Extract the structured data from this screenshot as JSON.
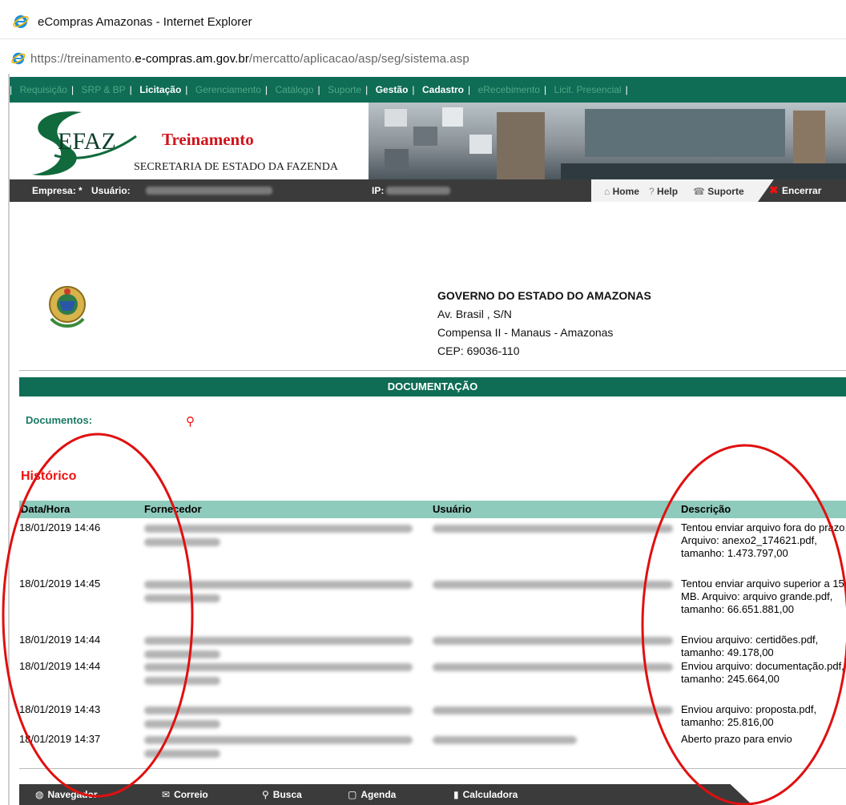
{
  "window": {
    "title": "eCompras Amazonas - Internet Explorer"
  },
  "address": {
    "scheme": "https://treinamento.",
    "domain": "e-compras.am.gov.br",
    "path": "/mercatto/aplicacao/asp/seg/sistema.asp"
  },
  "topnav": {
    "items": [
      {
        "label": "Requisição",
        "active": false
      },
      {
        "label": "SRP & BP",
        "active": false
      },
      {
        "label": "Licitação",
        "active": true
      },
      {
        "label": "Gerenciamento",
        "active": false
      },
      {
        "label": "Catálogo",
        "active": false
      },
      {
        "label": "Suporte",
        "active": false
      },
      {
        "label": "Gestão",
        "active": true
      },
      {
        "label": "Cadastro",
        "active": true
      },
      {
        "label": "eRecebimento",
        "active": false
      },
      {
        "label": "Licit. Presencial",
        "active": false
      }
    ]
  },
  "banner": {
    "logo_text": "EFAZ",
    "title": "Treinamento",
    "subtitle": "SECRETARIA DE ESTADO DA FAZENDA"
  },
  "userbar": {
    "empresa_label": "Empresa: *",
    "usuario_label": "Usuário:",
    "ip_label": "IP:",
    "home": "Home",
    "help": "Help",
    "suporte": "Suporte",
    "encerrar": "Encerrar"
  },
  "gov": {
    "line1": "GOVERNO DO ESTADO DO AMAZONAS",
    "line2": "Av. Brasil , S/N",
    "line3": "Compensa II - Manaus - Amazonas",
    "line4": "CEP: 69036-110"
  },
  "section": {
    "title": "DOCUMENTAÇÃO",
    "documentos_label": "Documentos:"
  },
  "historico": {
    "title": "Histórico",
    "headers": {
      "datahora": "Data/Hora",
      "fornecedor": "Fornecedor",
      "usuario": "Usuário",
      "descricao": "Descrição"
    },
    "rows": [
      {
        "datahora": "18/01/2019 14:46",
        "descricao": "Tentou enviar arquivo fora do prazo. Arquivo: anexo2_174621.pdf, tamanho: 1.473.797,00"
      },
      {
        "datahora": "18/01/2019 14:45",
        "descricao": "Tentou enviar arquivo superior a 15 MB. Arquivo: arquivo grande.pdf, tamanho: 66.651.881,00"
      },
      {
        "datahora": "18/01/2019 14:44",
        "descricao": "Enviou arquivo: certidões.pdf, tamanho: 49.178,00"
      },
      {
        "datahora": "18/01/2019 14:44",
        "descricao": "Enviou arquivo: documentação.pdf, tamanho: 245.664,00"
      },
      {
        "datahora": "18/01/2019 14:43",
        "descricao": "Enviou arquivo: proposta.pdf, tamanho: 25.816,00"
      },
      {
        "datahora": "18/01/2019 14:37",
        "descricao": "Aberto prazo para envio"
      }
    ]
  },
  "bottombar": {
    "navegador": "Navegador",
    "correio": "Correio",
    "busca": "Busca",
    "agenda": "Agenda",
    "calculadora": "Calculadora"
  },
  "colors": {
    "green": "#0f6d55",
    "header_green": "#8fcbbc",
    "red": "#e11111",
    "dark_bar": "#3b3b3b"
  },
  "icons": [
    "ie-logo-icon",
    "home-icon",
    "help-icon",
    "phone-icon",
    "close-icon",
    "paperclip-icon",
    "globe-icon",
    "mail-icon",
    "search-icon",
    "calendar-icon",
    "calculator-icon",
    "coat-of-arms-icon"
  ]
}
